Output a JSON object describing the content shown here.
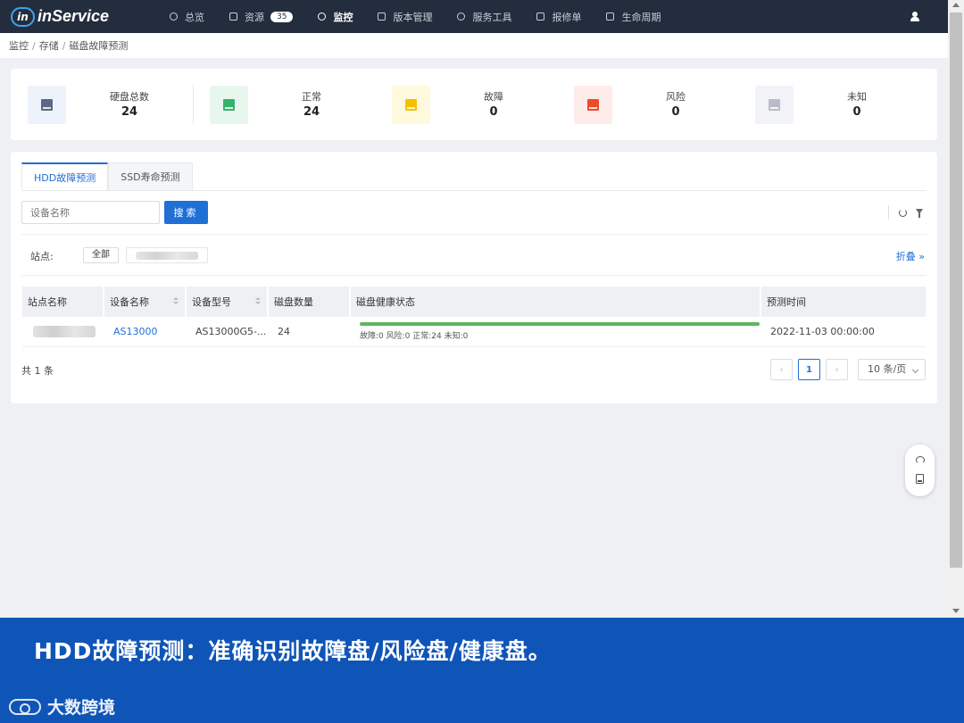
{
  "app": {
    "logo_mark": "in",
    "name": "inService"
  },
  "nav": {
    "items": [
      {
        "label": "总览",
        "icon": "home-icon"
      },
      {
        "label": "资源",
        "icon": "layers-icon",
        "badge": "35"
      },
      {
        "label": "监控",
        "icon": "gauge-icon",
        "active": true
      },
      {
        "label": "版本管理",
        "icon": "version-icon"
      },
      {
        "label": "服务工具",
        "icon": "shield-icon"
      },
      {
        "label": "报修单",
        "icon": "ticket-icon"
      },
      {
        "label": "生命周期",
        "icon": "lifecycle-icon"
      }
    ],
    "user_icon": "user-icon"
  },
  "breadcrumb": [
    "监控",
    "存储",
    "磁盘故障预测"
  ],
  "stats": [
    {
      "label": "硬盘总数",
      "value": "24",
      "color": "#5a6a82",
      "bg": "#eef3fb"
    },
    {
      "label": "正常",
      "value": "24",
      "color": "#35b36b",
      "bg": "#e8f7ee"
    },
    {
      "label": "故障",
      "value": "0",
      "color": "#f5c000",
      "bg": "#fff9de"
    },
    {
      "label": "风险",
      "value": "0",
      "color": "#ee4b2b",
      "bg": "#fdecea"
    },
    {
      "label": "未知",
      "value": "0",
      "color": "#b7bdc8",
      "bg": "#f1f3f6"
    }
  ],
  "tabs": [
    {
      "label": "HDD故障预测",
      "active": true
    },
    {
      "label": "SSD寿命预测",
      "active": false
    }
  ],
  "search": {
    "placeholder": "设备名称",
    "button": "搜索"
  },
  "filter": {
    "label": "站点:",
    "all": "全部",
    "collapse": "折叠"
  },
  "table": {
    "columns": [
      "站点名称",
      "设备名称",
      "设备型号",
      "磁盘数量",
      "磁盘健康状态",
      "预测时间"
    ],
    "rows": [
      {
        "site": "",
        "device": "AS13000",
        "model": "AS13000G5-...",
        "disk_count": "24",
        "health_summary": "故障:0  风险:0  正常:24  未知:0",
        "health_normal_fraction": 1.0,
        "predict_time": "2022-11-03 00:00:00"
      }
    ]
  },
  "pagination": {
    "total": "共 1 条",
    "current_page": "1",
    "page_size": "10 条/页"
  },
  "banner": {
    "text": "HDD故障预测：准确识别故障盘/风险盘/健康盘。",
    "watermark": "大数跨境"
  },
  "colors": {
    "primary": "#1f6fd6",
    "nav_bg": "#232d3d",
    "banner_bg": "#0f55b7",
    "health_ok": "#5cb85c"
  }
}
